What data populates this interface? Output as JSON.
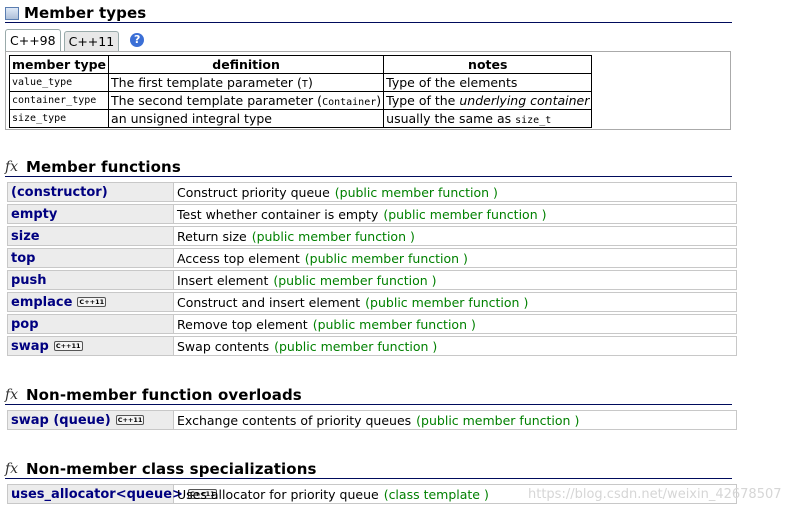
{
  "member_types": {
    "title": "Member types",
    "tabs": [
      "C++98",
      "C++11"
    ],
    "help_label": "?",
    "headers": [
      "member type",
      "definition",
      "notes"
    ],
    "rows": [
      {
        "type": "value_type",
        "def_text": "The first template parameter (",
        "def_code": "T",
        "def_close": ")",
        "notes_text": "Type of the elements",
        "notes_em": "",
        "notes_code": ""
      },
      {
        "type": "container_type",
        "def_text": "The second template parameter (",
        "def_code": "Container",
        "def_close": ")",
        "notes_text": "Type of the ",
        "notes_em": "underlying container",
        "notes_code": ""
      },
      {
        "type": "size_type",
        "def_text": "an unsigned integral type",
        "def_code": "",
        "def_close": "",
        "notes_text": "usually the same as ",
        "notes_em": "",
        "notes_code": "size_t"
      }
    ]
  },
  "member_functions": {
    "title": "Member functions",
    "icon": "fx",
    "items": [
      {
        "name": "(constructor)",
        "badge": "",
        "desc": "Construct priority queue",
        "kind": "(public member function )"
      },
      {
        "name": "empty",
        "badge": "",
        "desc": "Test whether container is empty",
        "kind": "(public member function )"
      },
      {
        "name": "size",
        "badge": "",
        "desc": "Return size",
        "kind": "(public member function )"
      },
      {
        "name": "top",
        "badge": "",
        "desc": "Access top element",
        "kind": "(public member function )"
      },
      {
        "name": "push",
        "badge": "",
        "desc": "Insert element",
        "kind": "(public member function )"
      },
      {
        "name": "emplace",
        "badge": "C++11",
        "desc": "Construct and insert element",
        "kind": "(public member function )"
      },
      {
        "name": "pop",
        "badge": "",
        "desc": "Remove top element",
        "kind": "(public member function )"
      },
      {
        "name": "swap",
        "badge": "C++11",
        "desc": "Swap contents",
        "kind": "(public member function )"
      }
    ]
  },
  "non_member_overloads": {
    "title": "Non-member function overloads",
    "icon": "fx",
    "items": [
      {
        "name": "swap (queue)",
        "badge": "C++11",
        "desc": "Exchange contents of priority queues",
        "kind": "(public member function )"
      }
    ]
  },
  "non_member_specializations": {
    "title": "Non-member class specializations",
    "icon": "fx",
    "items": [
      {
        "name": "uses_allocator<queue>",
        "badge": "C++11",
        "desc": "Uses allocator for priority queue",
        "kind": "(class template )"
      }
    ]
  },
  "watermark": "https://blog.csdn.net/weixin_42678507",
  "colors": {
    "link": "#000080",
    "kind": "#008000",
    "rule": "#000b5c",
    "name_cell_bg": "#ececec"
  }
}
